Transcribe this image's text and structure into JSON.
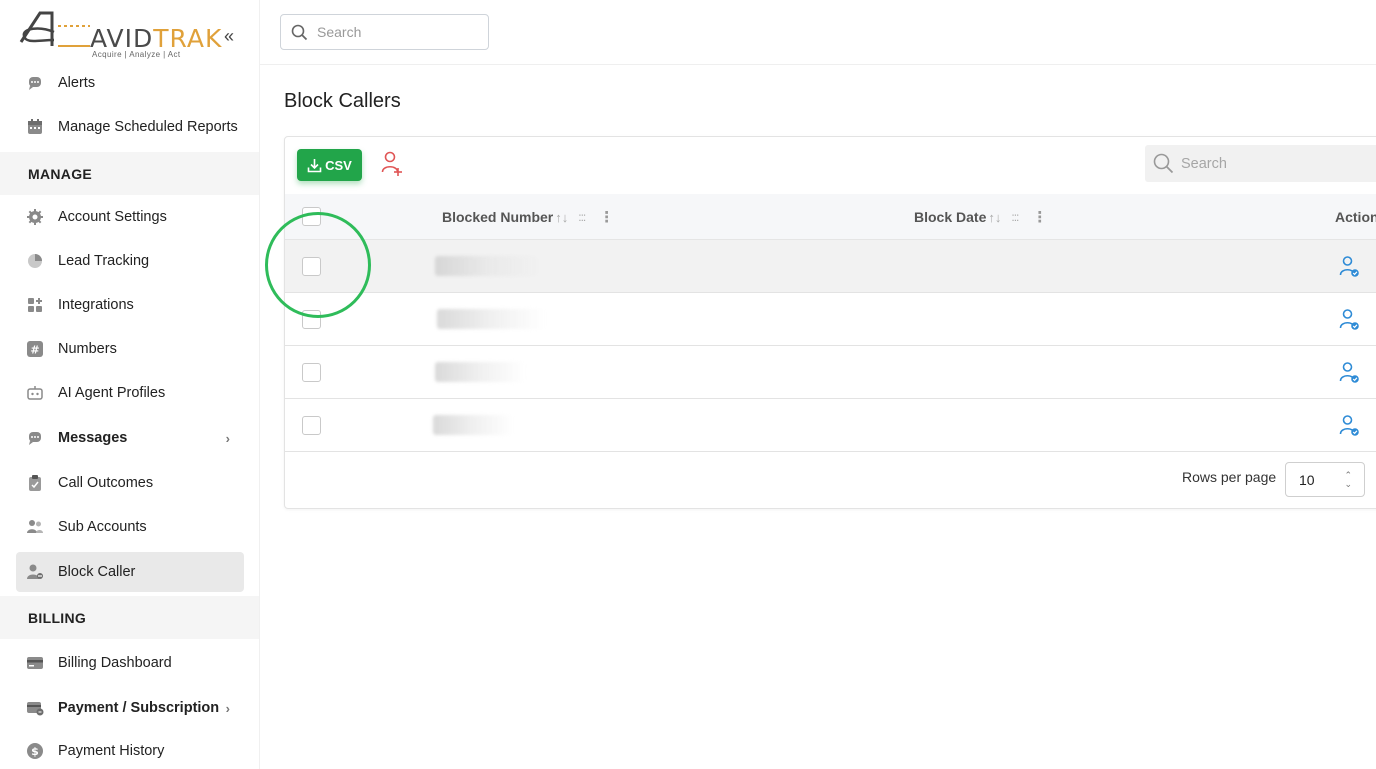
{
  "logo": {
    "brand_left": "AVID",
    "brand_right": "TRAK",
    "tagline": "Acquire   |   Analyze   |   Act"
  },
  "sidebar": {
    "collapse_icon": "double-chevron-left-icon",
    "items_top": [
      {
        "label": "Alerts",
        "icon": "chat-bubble-icon"
      },
      {
        "label": "Manage Scheduled Reports",
        "icon": "calendar-icon"
      }
    ],
    "section_manage": "MANAGE",
    "items_manage": [
      {
        "label": "Account Settings",
        "icon": "gear-icon"
      },
      {
        "label": "Lead Tracking",
        "icon": "pie-chart-icon"
      },
      {
        "label": "Integrations",
        "icon": "grid-plus-icon"
      },
      {
        "label": "Numbers",
        "icon": "hash-icon"
      },
      {
        "label": "AI Agent Profiles",
        "icon": "robot-icon"
      },
      {
        "label": "Messages",
        "icon": "chat-bubble-icon"
      },
      {
        "label": "Call Outcomes",
        "icon": "clipboard-check-icon"
      },
      {
        "label": "Sub Accounts",
        "icon": "users-icon"
      },
      {
        "label": "Block Caller",
        "icon": "user-block-icon"
      }
    ],
    "section_billing": "BILLING",
    "items_billing": [
      {
        "label": "Billing Dashboard",
        "icon": "credit-card-icon"
      },
      {
        "label": "Payment / Subscription",
        "icon": "card-swap-icon"
      },
      {
        "label": "Payment History",
        "icon": "dollar-circle-icon"
      }
    ]
  },
  "topbar": {
    "search_placeholder": "Search"
  },
  "main": {
    "title": "Block Callers",
    "csv_label": "CSV",
    "table_search_placeholder": "Search",
    "columns": {
      "blocked_number": "Blocked Number",
      "block_date": "Block Date",
      "action": "Action"
    },
    "rows_count_label": "Rows per page",
    "rows_per_page": "10"
  },
  "colors": {
    "csv_green": "#22a54a",
    "brand_orange": "#e0a13a",
    "action_blue": "#2e8bd6",
    "add_user_red": "#e05555",
    "focus_ring": "#2fbc5a"
  }
}
